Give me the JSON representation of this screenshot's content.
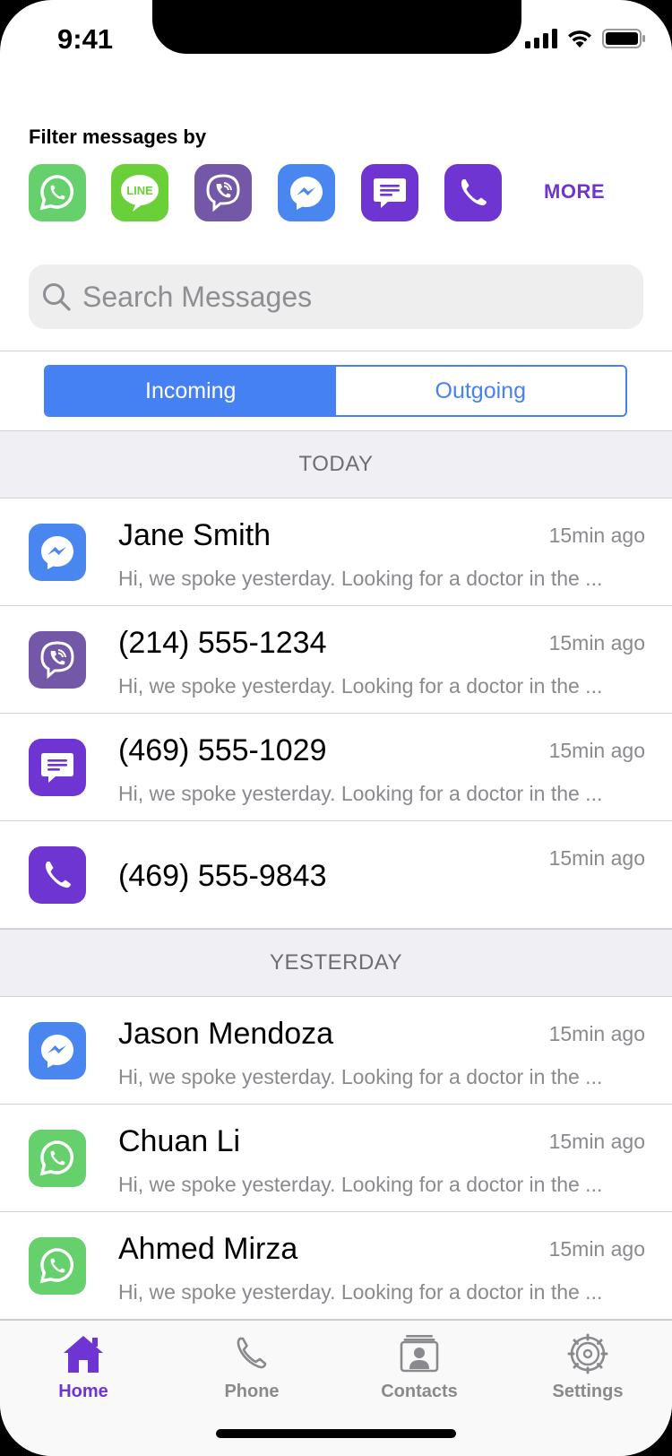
{
  "status_bar": {
    "time": "9:41"
  },
  "filter": {
    "title": "Filter messages by",
    "apps": [
      {
        "name": "whatsapp-icon",
        "color": "#66d06c"
      },
      {
        "name": "line-icon",
        "color": "#6ad03a",
        "label": "LINE"
      },
      {
        "name": "viber-icon",
        "color": "#7358a8"
      },
      {
        "name": "messenger-icon",
        "color": "#4a86f0"
      },
      {
        "name": "sms-icon",
        "color": "#6e35d2"
      },
      {
        "name": "phone-icon",
        "color": "#6e35d2"
      }
    ],
    "more_label": "MORE"
  },
  "search": {
    "placeholder": "Search Messages"
  },
  "segments": {
    "incoming": "Incoming",
    "outgoing": "Outgoing",
    "selected": "Incoming"
  },
  "sections": [
    {
      "header": "TODAY",
      "items": [
        {
          "name": "Jane Smith",
          "time": "15min ago",
          "preview": "Hi, we spoke yesterday. Looking for a doctor in the ...",
          "icon": "messenger-icon"
        },
        {
          "name": "(214) 555-1234",
          "time": "15min ago",
          "preview": "Hi, we spoke yesterday. Looking for a doctor in the ...",
          "icon": "viber-icon"
        },
        {
          "name": "(469) 555-1029",
          "time": "15min ago",
          "preview": "Hi, we spoke yesterday. Looking for a doctor in the ...",
          "icon": "sms-icon"
        },
        {
          "name": "(469) 555-9843",
          "time": "15min ago",
          "preview": "",
          "icon": "phone-icon"
        }
      ]
    },
    {
      "header": "YESTERDAY",
      "items": [
        {
          "name": "Jason Mendoza",
          "time": "15min ago",
          "preview": "Hi, we spoke yesterday. Looking for a doctor in the ...",
          "icon": "messenger-icon"
        },
        {
          "name": "Chuan Li",
          "time": "15min ago",
          "preview": "Hi, we spoke yesterday. Looking for a doctor in the ...",
          "icon": "whatsapp-icon"
        },
        {
          "name": "Ahmed Mirza",
          "time": "15min ago",
          "preview": "Hi, we spoke yesterday. Looking for a doctor in the ...",
          "icon": "whatsapp-icon"
        }
      ]
    }
  ],
  "tabbar": {
    "tabs": [
      {
        "label": "Home",
        "icon": "home-icon",
        "active": true
      },
      {
        "label": "Phone",
        "icon": "phone-icon",
        "active": false
      },
      {
        "label": "Contacts",
        "icon": "contacts-icon",
        "active": false
      },
      {
        "label": "Settings",
        "icon": "settings-icon",
        "active": false
      }
    ]
  },
  "colors": {
    "accent": "#6e35d2",
    "segment_blue": "#4681f4",
    "whatsapp": "#66d06c",
    "line": "#6ad03a",
    "viber": "#7358a8",
    "messenger": "#4a86f0"
  }
}
